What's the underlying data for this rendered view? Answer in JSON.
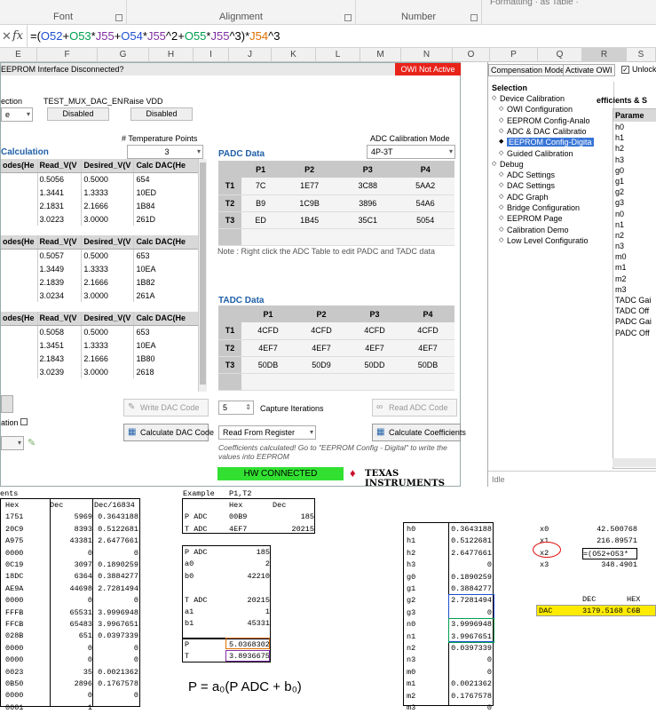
{
  "ribbon": {
    "font": "Font",
    "alignment": "Alignment",
    "number": "Number",
    "formatting": "Formatting · as Table ·"
  },
  "formula_bar": {
    "cancel": "✕",
    "enter": "✓",
    "fx": "fx",
    "parts": [
      {
        "t": "=(",
        "c": "k"
      },
      {
        "t": "O52",
        "c": "blue"
      },
      {
        "t": "+",
        "c": "k"
      },
      {
        "t": "O53",
        "c": "grn"
      },
      {
        "t": "*",
        "c": "k"
      },
      {
        "t": "J55",
        "c": "pur"
      },
      {
        "t": "+",
        "c": "k"
      },
      {
        "t": "O54",
        "c": "blue"
      },
      {
        "t": "*",
        "c": "k"
      },
      {
        "t": "J55",
        "c": "pur"
      },
      {
        "t": "^2+",
        "c": "k"
      },
      {
        "t": "O55",
        "c": "grn"
      },
      {
        "t": "*",
        "c": "k"
      },
      {
        "t": "J55",
        "c": "pur"
      },
      {
        "t": "^3)*",
        "c": "k"
      },
      {
        "t": "J54",
        "c": "org"
      },
      {
        "t": "^3",
        "c": "k"
      }
    ]
  },
  "columns": [
    "E",
    "F",
    "G",
    "H",
    "I",
    "J",
    "K",
    "L",
    "M",
    "N",
    "O",
    "P",
    "Q",
    "R",
    "S"
  ],
  "app": {
    "title": "EEPROM Interface Disconnected?",
    "owi_status": "OWI Not Active",
    "col_labels": {
      "ection": "ection",
      "test_mux": "TEST_MUX_DAC_EN",
      "raise_vdd": "Raise VDD"
    },
    "combo_e": "e",
    "disabled1": "Disabled",
    "disabled2": "Disabled",
    "calc_title": "Calculation",
    "temp_points_label": "# Temperature Points",
    "temp_points": "3",
    "adc_mode_label": "ADC Calibration Mode",
    "adc_mode": "4P-3T",
    "cal_headers": [
      "odes(He",
      "Read_V(V",
      "Desired_V(V",
      "Calc DAC(He"
    ],
    "cal_group1": [
      [
        "",
        "0.5056",
        "0.5000",
        "654"
      ],
      [
        "",
        "1.3441",
        "1.3333",
        "10ED"
      ],
      [
        "",
        "2.1831",
        "2.1666",
        "1B84"
      ],
      [
        "",
        "3.0223",
        "3.0000",
        "261D"
      ]
    ],
    "cal_group2": [
      [
        "",
        "0.5057",
        "0.5000",
        "653"
      ],
      [
        "",
        "1.3449",
        "1.3333",
        "10EA"
      ],
      [
        "",
        "2.1839",
        "2.1666",
        "1B82"
      ],
      [
        "",
        "3.0234",
        "3.0000",
        "261A"
      ]
    ],
    "cal_group3": [
      [
        "",
        "0.5058",
        "0.5000",
        "653"
      ],
      [
        "",
        "1.3451",
        "1.3333",
        "10EA"
      ],
      [
        "",
        "2.1843",
        "2.1666",
        "1B80"
      ],
      [
        "",
        "3.0239",
        "3.0000",
        "2618"
      ]
    ],
    "padc_title": "PADC Data",
    "padc_headers": [
      "",
      "P1",
      "P2",
      "P3",
      "P4"
    ],
    "padc_rows": [
      [
        "T1",
        "7C",
        "1E77",
        "3C88",
        "5AA2"
      ],
      [
        "T2",
        "B9",
        "1C9B",
        "3896",
        "54A6"
      ],
      [
        "T3",
        "ED",
        "1B45",
        "35C1",
        "5054"
      ]
    ],
    "padc_note": "Note : Right click the ADC Table to edit PADC and TADC data",
    "tadc_title": "TADC Data",
    "tadc_headers": [
      "",
      "P1",
      "P2",
      "P3",
      "P4"
    ],
    "tadc_rows": [
      [
        "T1",
        "4CFD",
        "4CFD",
        "4CFD",
        "4CFD"
      ],
      [
        "T2",
        "4EF7",
        "4EF7",
        "4EF7",
        "4EF7"
      ],
      [
        "T3",
        "50DB",
        "50D9",
        "50DD",
        "50DB"
      ]
    ],
    "write_dac": "Write DAC Code",
    "calc_dac": "Calculate DAC Code",
    "capture_value": "5",
    "capture_label": "Capture Iterations",
    "read_adc": "Read ADC Code",
    "read_from": "Read From Register",
    "calc_coeff": "Calculate Coefficients",
    "ation": "ation",
    "coeff_msg": "Coefficients calculated! Go to \"EEPROM Config - Digital\" to write the values into EEPROM",
    "hw_status": "HW CONNECTED",
    "ti_logo": "TEXAS INSTRUMENTS"
  },
  "right_panel": {
    "tabs": [
      "Compensation Mode",
      "Activate OWI",
      "Unlock"
    ],
    "tree_header": "Selection",
    "tree": [
      "Device Calibration",
      "OWI Configuration",
      "EEPROM Config-Analo",
      "ADC & DAC Calibratio",
      "EEPROM Config-Digita",
      "Guided Calibration",
      "Debug",
      "ADC Settings",
      "DAC Settings",
      "ADC Graph",
      "Bridge Configuration",
      "EEPROM Page",
      "Calibration Demo",
      "Low Level Configuratio"
    ],
    "coeff_title": "efficients & S",
    "param_header": "Parame",
    "params": [
      "h0",
      "h1",
      "h2",
      "h3",
      "g0",
      "g1",
      "g2",
      "g3",
      "n0",
      "n1",
      "n2",
      "n3",
      "m0",
      "m1",
      "m2",
      "m3",
      "TADC Gai",
      "TADC Off",
      "PADC Gai",
      "PADC Off"
    ],
    "status": "Idle"
  },
  "sheet": {
    "left_title": "ents",
    "left_headers": [
      "Hex",
      "Dec",
      "Dec/16834"
    ],
    "left_rows": [
      [
        "1751",
        "5969",
        "0.3643188"
      ],
      [
        "20C9",
        "8393",
        "0.5122681"
      ],
      [
        "A975",
        "43381",
        "2.6477661"
      ],
      [
        "0000",
        "0",
        "0"
      ],
      [
        "0C19",
        "3097",
        "0.1890259"
      ],
      [
        "18DC",
        "6364",
        "0.3884277"
      ],
      [
        "AE9A",
        "44698",
        "2.7281494"
      ],
      [
        "0000",
        "0",
        "0"
      ],
      [
        "FFFB",
        "65531",
        "3.9996948"
      ],
      [
        "FFCB",
        "65483",
        "3.9967651"
      ],
      [
        "028B",
        "651",
        "0.0397339"
      ],
      [
        "0000",
        "0",
        "0"
      ],
      [
        "0000",
        "0",
        "0"
      ],
      [
        "0023",
        "35",
        "0.0021362"
      ],
      [
        "0B50",
        "2896",
        "0.1767578"
      ],
      [
        "0000",
        "0",
        "0"
      ],
      [
        "0001",
        "1",
        ""
      ]
    ],
    "example_label": "Example",
    "example_val": "P1,T2",
    "ex_headers": [
      "Hex",
      "Dec"
    ],
    "ex_padc": [
      "P ADC",
      "00B9",
      "185"
    ],
    "ex_tadc": [
      "T ADC",
      "4EF7",
      "20215"
    ],
    "ex_rows": [
      [
        "P ADC",
        "185"
      ],
      [
        "a0",
        "2"
      ],
      [
        "b0",
        "42210"
      ],
      [
        "",
        ""
      ],
      [
        "T ADC",
        "20215"
      ],
      [
        "a1",
        "1"
      ],
      [
        "b1",
        "45331"
      ]
    ],
    "ex_P": [
      "P",
      "5.0368302"
    ],
    "ex_T": [
      "T",
      "3.8936675"
    ],
    "coef_rows": [
      [
        "h0",
        "0.3643188"
      ],
      [
        "h1",
        "0.5122681"
      ],
      [
        "h2",
        "2.6477661"
      ],
      [
        "h3",
        "0"
      ],
      [
        "g0",
        "0.1890259"
      ],
      [
        "g1",
        "0.3884277"
      ],
      [
        "g2",
        "2.7281494"
      ],
      [
        "g3",
        "0"
      ],
      [
        "n0",
        "3.9996948"
      ],
      [
        "n1",
        "3.9967651"
      ],
      [
        "n2",
        "0.0397339"
      ],
      [
        "n3",
        "0"
      ],
      [
        "m0",
        "0"
      ],
      [
        "m1",
        "0.0021362"
      ],
      [
        "m2",
        "0.1767578"
      ],
      [
        "m3",
        "0"
      ]
    ],
    "x_rows": [
      [
        "x0",
        "42.500768"
      ],
      [
        "x1",
        "216.89571"
      ],
      [
        "x2",
        "=(O52+O53*"
      ],
      [
        "x3",
        "348.4901"
      ]
    ],
    "dec_label": "DEC",
    "hex_label": "HEX",
    "dac": [
      "DAC",
      "3179.5168",
      "C6B"
    ],
    "eq1": "P = a₀(P ADC + b₀)"
  }
}
